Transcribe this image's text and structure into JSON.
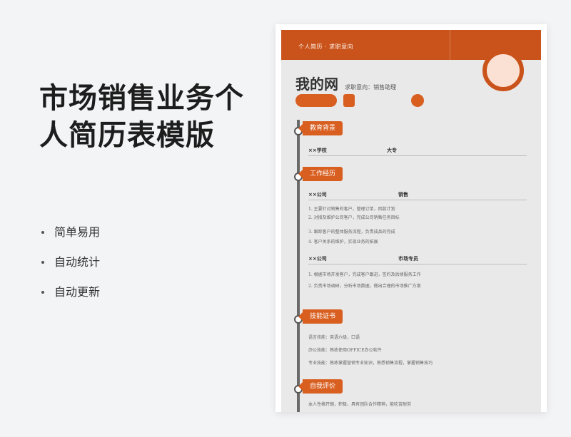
{
  "page": {
    "title_lines": [
      "市场销售业务个",
      "人简历表模版"
    ],
    "features": [
      "简单易用",
      "自动统计",
      "自动更新"
    ]
  },
  "resume": {
    "header_bar_text": "个人简历 · 求职意向",
    "name": "我的网",
    "job_title": "求职意向：销售助理",
    "colors": {
      "accent": "#d85f20",
      "bar": "#c9531a",
      "paper": "#e9e9e9"
    },
    "sections": {
      "education": {
        "heading": "教育背景",
        "school": "××学校",
        "degree": "大专"
      },
      "work": {
        "heading": "工作经历",
        "job1": {
          "company": "××公司",
          "role": "销售",
          "lines": [
            "1. 主要针对销售的客户，管理订单，回款计划",
            "2. 对接及维护公司客户，完成公司销售任务目标",
            "3. 跟踪客户的整体服务流程，负责成品的完成",
            "4. 客户关系的维护，实现业务的拓展"
          ]
        },
        "job2": {
          "company": "××公司",
          "role": "市场专员",
          "lines": [
            "1. 根据市场开发客户，完成客户跟进，签约及后续服务工作",
            "2. 负责市场调研，分析市场数据，做出合理的市场推广方案"
          ]
        }
      },
      "skills": {
        "heading": "技能证书",
        "lines": [
          "语言技能：英语六级，口语",
          "办公技能：熟练使用OFFICE办公软件",
          "专业技能：熟练掌握营销专业知识，熟悉销售流程，掌握销售技巧"
        ]
      },
      "self": {
        "heading": "自我评价",
        "lines": [
          "本人性格开朗，积极，具有团队合作精神，能吃苦耐劳"
        ]
      }
    }
  }
}
